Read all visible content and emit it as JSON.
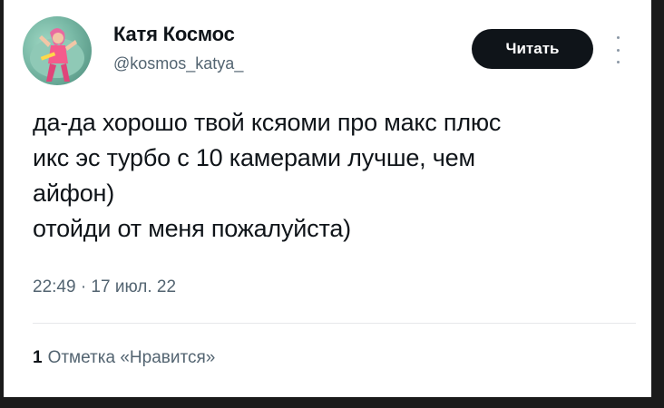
{
  "author": {
    "name": "Катя Космос",
    "handle": "@kosmos_katya_",
    "avatar_icon": "profile-photo"
  },
  "follow_button": {
    "label": "Читать"
  },
  "more_menu": {
    "icon": "vertical-ellipsis-icon"
  },
  "tweet": {
    "lines": [
      "да-да хорошо твой ксяоми про макс плюс",
      "икс эс турбо с 10 камерами лучше, чем",
      "айфон)",
      "отойди от меня пожалуйста)"
    ],
    "timestamp": "22:49 · 17 июл. 22"
  },
  "stats": {
    "likes_count": "1",
    "likes_label": "Отметка «Нравится»"
  },
  "colors": {
    "button_bg": "#0f1419",
    "secondary_text": "#536471",
    "frame": "#1b1b1b"
  }
}
